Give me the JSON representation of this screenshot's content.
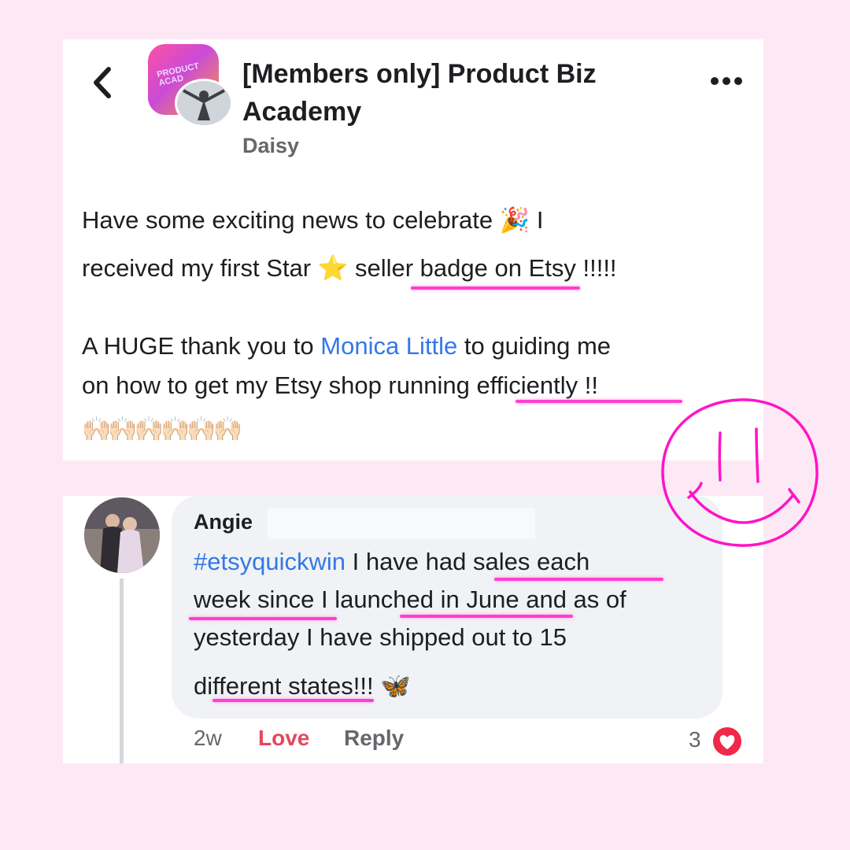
{
  "header": {
    "title_line1": "[Members only] Product Biz",
    "title_line2": "Academy",
    "poster": "Daisy",
    "group_icon_text": "PRODUCT ACAD"
  },
  "post": {
    "line1": "Have some exciting news to celebrate 🎉 I",
    "line2_prefix": "received my first Star ",
    "line2_star": "⭐",
    "line2_suffix": " seller badge on Etsy !!!!!",
    "line3_prefix": "A HUGE thank you to ",
    "line3_mention": "Monica Little",
    "line3_suffix": " to guiding me",
    "line4": "on how to get my Etsy shop running efficiently !!",
    "line5_emoji": "🙌🏻🙌🏻🙌🏻🙌🏻🙌🏻🙌🏻"
  },
  "comment": {
    "author": "Angie",
    "hashtag": "#etsyquickwin",
    "line1_suffix": " I have had sales each",
    "line2": "week since I launched in June and as of",
    "line3": "yesterday I have shipped out to 15",
    "line4": "different states!!! 🦋",
    "time": "2w",
    "love_label": "Love",
    "reply_label": "Reply",
    "reaction_count": "3"
  },
  "colors": {
    "background": "#fde9f5",
    "highlight": "#ff3fd0",
    "mention": "#3578e5",
    "love": "#e4475d"
  },
  "icons": {
    "back": "chevron-left-icon",
    "more": "more-horizontal-icon",
    "reaction": "heart-reaction-icon",
    "doodle": "smiley-doodle"
  }
}
